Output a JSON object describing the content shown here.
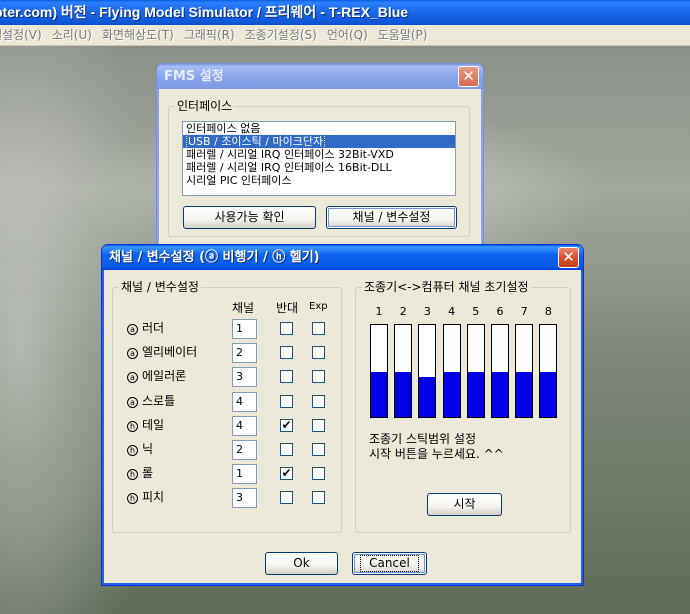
{
  "app": {
    "title": "pter.com) 버전 - Flying Model Simulator / 프리웨어 - T-REX_Blue",
    "menu": [
      "헬설정(V)",
      "소리(U)",
      "화면해상도(T)",
      "그래픽(R)",
      "조종기설정(S)",
      "언어(Q)",
      "도움말(P)"
    ]
  },
  "fms_dialog": {
    "title": "FMS 설정",
    "group_label": "인터페이스",
    "interfaces": [
      "인터페이스 없음",
      "USB / 조이스틱 / 마이크단자",
      "패러렐 / 시리얼 IRQ 인터페이스 32Bit-VXD",
      "패러렐 / 시리얼 IRQ 인터페이스 16Bit-DLL",
      "시리얼 PIC 인터페이스"
    ],
    "selected_index": 1,
    "check_button": "사용가능 확인",
    "channel_button": "채널 / 변수설정"
  },
  "channel_dialog": {
    "title": "채널 / 변수설정 (ⓐ 비행기 / ⓗ 헬기)",
    "left_group": "채널 / 변수설정",
    "col_channel": "채널",
    "col_reverse": "반대",
    "col_exp": "Exp",
    "rows": [
      {
        "mark": "a",
        "label": "러더",
        "channel": "1",
        "reverse": false,
        "exp": false
      },
      {
        "mark": "a",
        "label": "엘리베이터",
        "channel": "2",
        "reverse": false,
        "exp": false
      },
      {
        "mark": "a",
        "label": "에일러론",
        "channel": "3",
        "reverse": false,
        "exp": false
      },
      {
        "mark": "a",
        "label": "스로틀",
        "channel": "4",
        "reverse": false,
        "exp": false
      },
      {
        "mark": "h",
        "label": "테일",
        "channel": "4",
        "reverse": true,
        "exp": false
      },
      {
        "mark": "h",
        "label": "닉",
        "channel": "2",
        "reverse": false,
        "exp": false
      },
      {
        "mark": "h",
        "label": "롤",
        "channel": "1",
        "reverse": true,
        "exp": false
      },
      {
        "mark": "h",
        "label": "피치",
        "channel": "3",
        "reverse": false,
        "exp": false
      }
    ],
    "right_group": "조종기<->컴퓨터 채널 초기설정",
    "channel_numbers": [
      "1",
      "2",
      "3",
      "4",
      "5",
      "6",
      "7",
      "8"
    ],
    "channel_levels": [
      0.49,
      0.49,
      0.43,
      0.49,
      0.49,
      0.49,
      0.49,
      0.49
    ],
    "bar_fill_color": "#0000e6",
    "instruction_line1": "조종기 스틱범위 설정",
    "instruction_line2": "시작 버튼을 누르세요. ^^",
    "start_button": "시작",
    "ok_button": "Ok",
    "cancel_button": "Cancel"
  }
}
